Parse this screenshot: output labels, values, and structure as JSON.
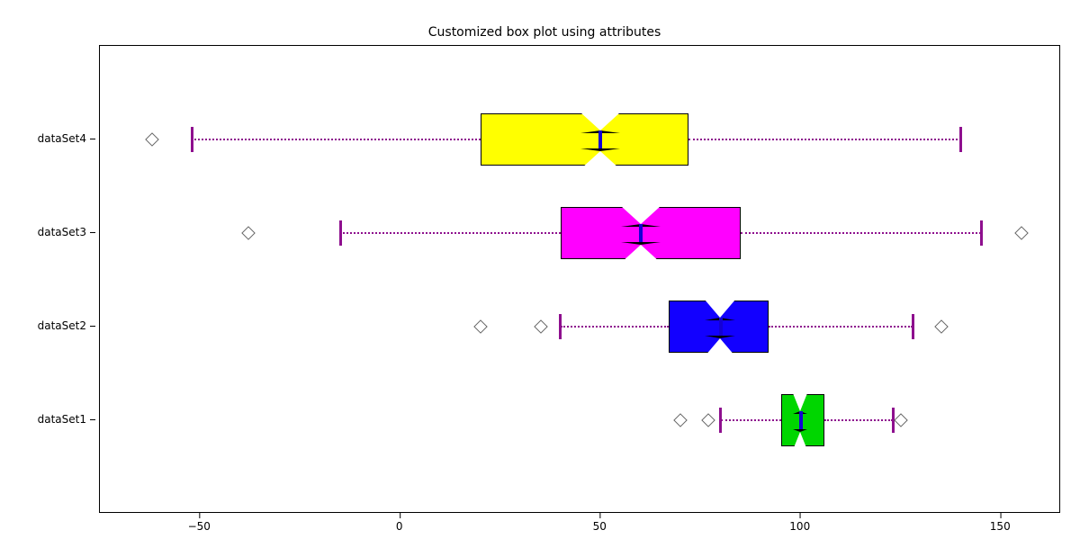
{
  "chart_data": {
    "type": "boxplot",
    "orientation": "horizontal",
    "title": "Customized box plot using attributes",
    "xlabel": "",
    "ylabel": "",
    "x_ticks": [
      -50,
      0,
      50,
      100,
      150
    ],
    "x_range": [
      -75,
      165
    ],
    "categories": [
      "dataSet1",
      "dataSet2",
      "dataSet3",
      "dataSet4"
    ],
    "series": [
      {
        "name": "dataSet1",
        "q1": 95,
        "median": 100,
        "q3": 106,
        "whisker_low": 80,
        "whisker_high": 123,
        "fliers": [
          70,
          77,
          125
        ],
        "fill": "#00d600",
        "notch_lo": 98,
        "notch_hi": 102
      },
      {
        "name": "dataSet2",
        "q1": 67,
        "median": 80,
        "q3": 92,
        "whisker_low": 40,
        "whisker_high": 128,
        "fliers": [
          20,
          35,
          135
        ],
        "fill": "#1200ff",
        "notch_lo": 76,
        "notch_hi": 84
      },
      {
        "name": "dataSet3",
        "q1": 40,
        "median": 60,
        "q3": 85,
        "whisker_low": -15,
        "whisker_high": 145,
        "fliers": [
          -38,
          155
        ],
        "fill": "#ff00ff",
        "notch_lo": 55,
        "notch_hi": 65
      },
      {
        "name": "dataSet4",
        "q1": 20,
        "median": 50,
        "q3": 72,
        "whisker_low": -52,
        "whisker_high": 140,
        "fliers": [
          -62
        ],
        "fill": "#ffff00",
        "notch_lo": 45,
        "notch_hi": 55
      }
    ],
    "style": {
      "whisker_color": "#8e0f8e",
      "whisker_linestyle": "dotted",
      "median_color": "#1400d6",
      "flier_marker": "diamond",
      "notched": true
    }
  }
}
